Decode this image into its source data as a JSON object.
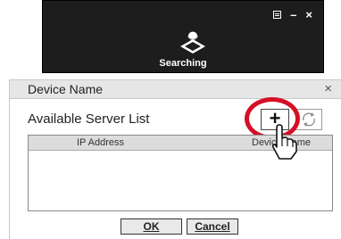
{
  "search_widget": {
    "status_label": "Searching",
    "minimize_glyph": "–",
    "close_glyph": "×",
    "menu_icon": "menu-icon",
    "status_icon": "magnifier-icon"
  },
  "dialog": {
    "title": "Device Name",
    "close_glyph": "×",
    "section_label": "Available Server List",
    "add_button_glyph": "+",
    "refresh_icon": "refresh-icon",
    "table": {
      "columns": [
        "IP Address",
        "Device Name"
      ],
      "rows": []
    },
    "ok_label": "OK",
    "cancel_label": "Cancel"
  },
  "colors": {
    "highlight": "#d60f26",
    "search_bg": "#1d1d1d"
  }
}
